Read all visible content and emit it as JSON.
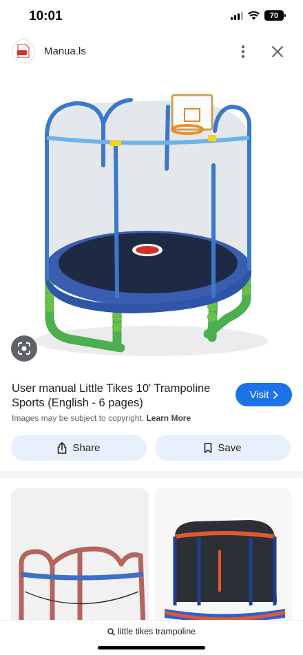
{
  "status": {
    "time": "10:01",
    "battery": "70"
  },
  "header": {
    "site_name": "Manua.ls",
    "favicon_label": "PDF"
  },
  "result": {
    "title": "User manual Little Tikes 10' Trampoline Sports (English - 6 pages)",
    "visit_label": "Visit",
    "copyright_text": "Images may be subject to copyright.",
    "learn_more_label": "Learn More"
  },
  "actions": {
    "share_label": "Share",
    "save_label": "Save"
  },
  "search": {
    "query": "little tikes trampoline"
  },
  "colors": {
    "accent": "#1a73e8",
    "button_bg": "#e8f0fe"
  }
}
